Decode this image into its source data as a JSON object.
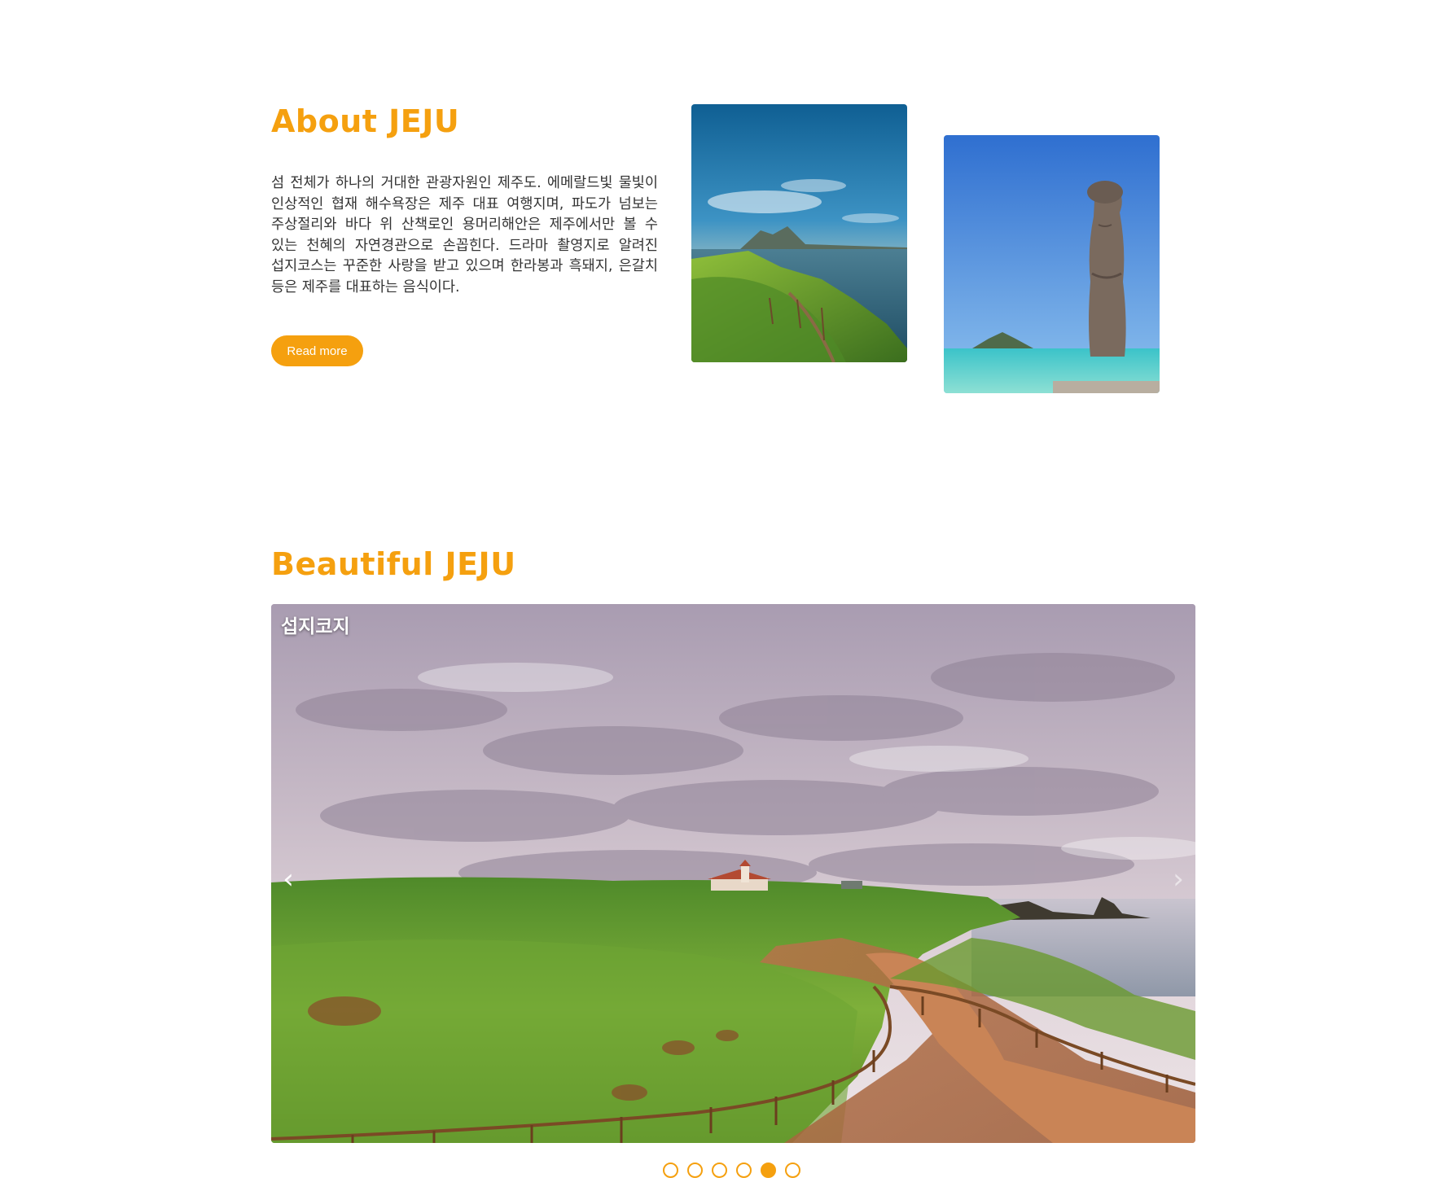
{
  "about": {
    "title": "About JEJU",
    "body": "섬 전체가 하나의 거대한 관광자원인 제주도. 에메랄드빛 물빛이 인상적인 협재 해수욕장은 제주 대표 여행지며, 파도가 넘보는 주상절리와 바다 위 산책로인 용머리해안은 제주에서만 볼 수 있는 천혜의 자연경관으로 손꼽힌다. 드라마 촬영지로 알려진 섭지코스는 꾸준한 사랑을 받고 있으며 한라봉과 흑돼지, 은갈치 등은 제주를 대표하는 음식이다.",
    "read_more_label": "Read more"
  },
  "gallery": {
    "title": "Beautiful JEJU",
    "caption": "섭지코지",
    "prev_glyph": "‹",
    "next_glyph": "›",
    "slide_count": 6,
    "active_slide": 5
  },
  "colors": {
    "accent": "#f5a00f"
  }
}
